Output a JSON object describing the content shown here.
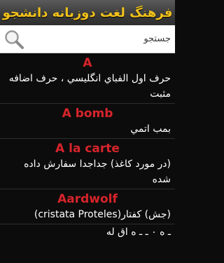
{
  "app": {
    "title": "فرهنگ لغت دوزبانه دانشجو"
  },
  "search": {
    "placeholder": "جستجو",
    "value": "",
    "icon": "magnifier-icon"
  },
  "entries": [
    {
      "word": "A",
      "meaning": "حرف اول الفباي انگليسي ، حرف اضافه مثبت"
    },
    {
      "word": "A bomb",
      "meaning": "بمب اتمي"
    },
    {
      "word": "A la carte",
      "meaning": "(در مورد كاغذ) جداجدا سفارش داده شده"
    },
    {
      "word": "Aardwolf",
      "meaning": "(جش) كفتار(cristata Proteles)"
    },
    {
      "word": "",
      "meaning": "ـ ه ٠ ـ ـ ه اق له"
    }
  ],
  "colors": {
    "title": "#f1c21b",
    "word": "#d7242b",
    "meaning": "#ffffff",
    "background": "#0c0c0c"
  }
}
